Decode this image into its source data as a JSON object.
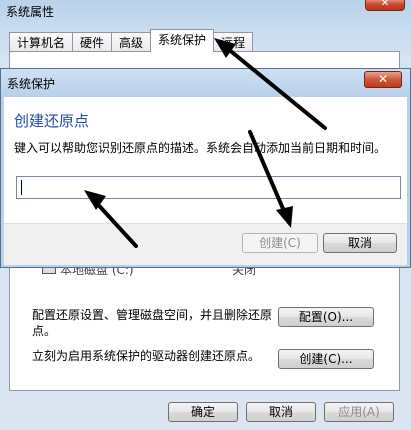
{
  "system_properties": {
    "title": "系统属性",
    "tabs": [
      "计算机名",
      "硬件",
      "高级",
      "系统保护",
      "远程"
    ],
    "active_tab": "系统保护",
    "drive_label": "本地磁盘 (C:)",
    "drive_status": "关闭",
    "config_text": "配置还原设置、管理磁盘空间，并且删除还原点。",
    "config_button": "配置(O)...",
    "create_text": "立刻为启用系统保护的驱动器创建还原点。",
    "create_button": "创建(C)...",
    "ok_button": "确定",
    "cancel_button": "取消",
    "apply_button": "应用(A)"
  },
  "dialog": {
    "title": "系统保护",
    "heading": "创建还原点",
    "description": "键入可以帮助您识别还原点的描述。系统会自动添加当前日期和时间。",
    "input_value": "",
    "create_button": "创建(C)",
    "cancel_button": "取消"
  },
  "colors": {
    "heading_blue": "#1e4ea1",
    "annotation_black": "#000000",
    "close_red": "#c9472e"
  }
}
